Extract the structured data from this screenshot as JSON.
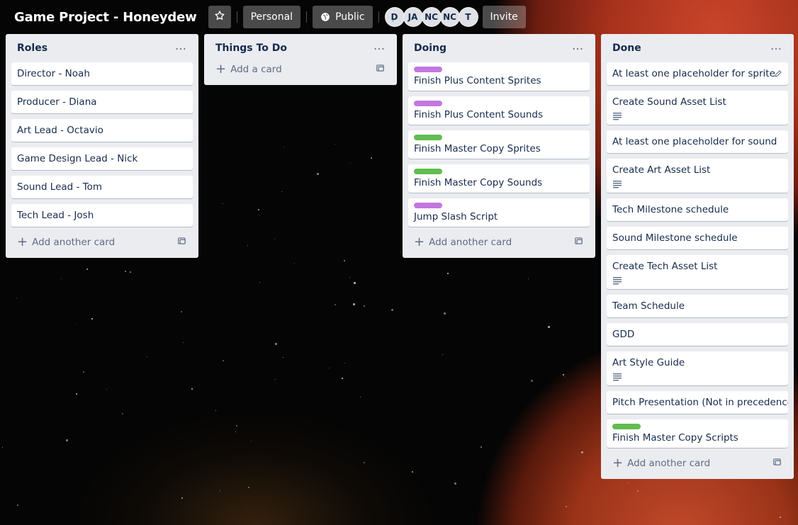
{
  "header": {
    "board_title": "Game Project - Honeydew",
    "star_icon": "star-icon",
    "team_button": "Personal",
    "visibility_button": "Public",
    "visibility_icon": "globe-icon",
    "members": [
      "D",
      "JA",
      "NC",
      "NC",
      "T"
    ],
    "invite_button": "Invite"
  },
  "lists": [
    {
      "title": "Roles",
      "cards": [
        {
          "title": "Director - Noah"
        },
        {
          "title": "Producer - Diana"
        },
        {
          "title": "Art Lead - Octavio"
        },
        {
          "title": "Game Design Lead - Nick"
        },
        {
          "title": "Sound Lead - Tom"
        },
        {
          "title": "Tech Lead - Josh"
        }
      ],
      "add_label": "Add another card"
    },
    {
      "title": "Things To Do",
      "cards": [],
      "add_label": "Add a card"
    },
    {
      "title": "Doing",
      "cards": [
        {
          "title": "Finish Plus Content Sprites",
          "label_color": "#c377e0"
        },
        {
          "title": "Finish Plus Content Sounds",
          "label_color": "#c377e0"
        },
        {
          "title": "Finish Master Copy Sprites",
          "label_color": "#61bd4f"
        },
        {
          "title": "Finish Master Copy Sounds",
          "label_color": "#61bd4f"
        },
        {
          "title": "Jump Slash Script",
          "label_color": "#c377e0"
        }
      ],
      "add_label": "Add another card"
    },
    {
      "title": "Done",
      "cards": [
        {
          "title": "At least one placeholder for sprite",
          "edit_icon": "pencil-icon"
        },
        {
          "title": "Create Sound Asset List",
          "has_description": true
        },
        {
          "title": "At least one placeholder for sound"
        },
        {
          "title": "Create Art Asset List",
          "has_description": true
        },
        {
          "title": "Tech Milestone schedule"
        },
        {
          "title": "Sound Milestone schedule"
        },
        {
          "title": "Create Tech Asset List",
          "has_description": true
        },
        {
          "title": "Team Schedule"
        },
        {
          "title": "GDD"
        },
        {
          "title": "Art Style Guide",
          "has_description": true
        },
        {
          "title": "Pitch Presentation (Not in precedence)"
        },
        {
          "title": "Finish Master Copy Scripts",
          "label_color": "#61bd4f"
        }
      ],
      "add_label": "Add another card"
    }
  ]
}
